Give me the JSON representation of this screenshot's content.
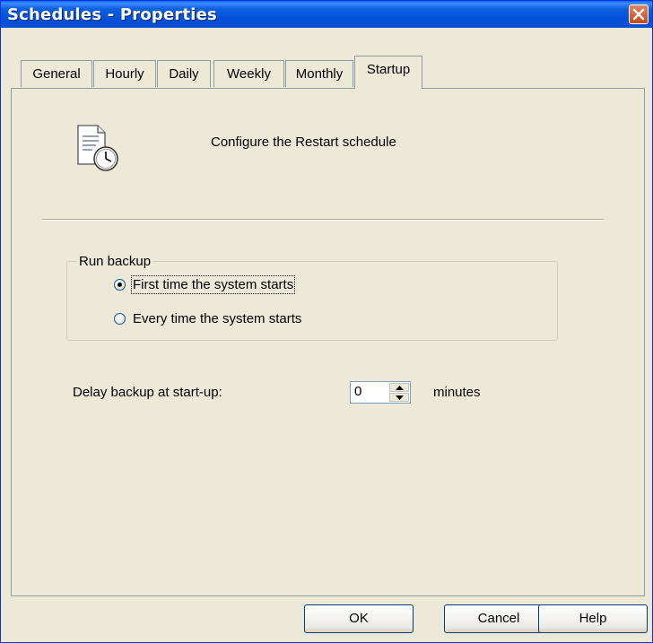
{
  "window": {
    "title": "Schedules - Properties"
  },
  "tabs": [
    {
      "label": "General"
    },
    {
      "label": "Hourly"
    },
    {
      "label": "Daily"
    },
    {
      "label": "Weekly"
    },
    {
      "label": "Monthly"
    },
    {
      "label": "Startup",
      "active": true
    }
  ],
  "startup": {
    "description": "Configure the Restart schedule",
    "icon": "schedule-clock-icon",
    "run_backup": {
      "legend": "Run backup",
      "options": [
        {
          "label": "First time the system starts",
          "checked": true
        },
        {
          "label": "Every time the system starts",
          "checked": false
        }
      ]
    },
    "delay": {
      "label": "Delay backup at start-up:",
      "value": "0",
      "units": "minutes"
    }
  },
  "buttons": {
    "ok": "OK",
    "cancel": "Cancel",
    "help": "Help"
  },
  "colors": {
    "titlebar": "#0054e3",
    "dialog_bg": "#ece9d8",
    "close_button": "#d9542b"
  }
}
